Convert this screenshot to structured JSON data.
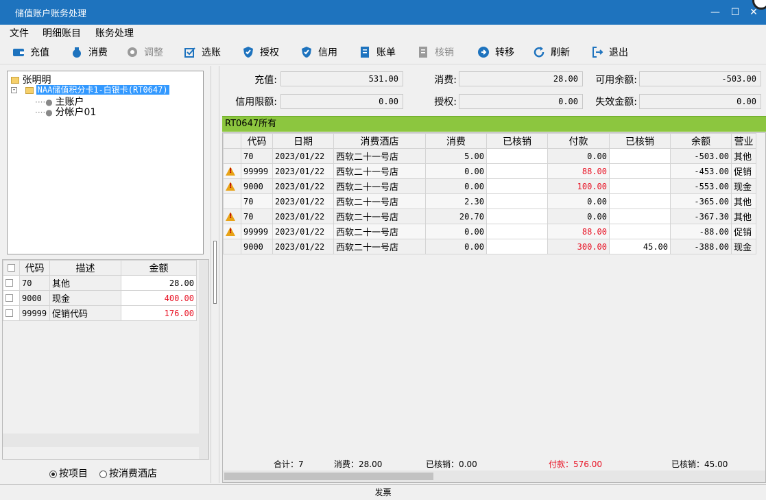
{
  "window": {
    "title": "储值账户账务处理"
  },
  "menu": [
    "文件",
    "明细账目",
    "账务处理"
  ],
  "toolbar": [
    {
      "label": "充值",
      "icon": "wallet-icon",
      "enabled": true
    },
    {
      "label": "消费",
      "icon": "money-bag-icon",
      "enabled": true
    },
    {
      "label": "调整",
      "icon": "adjust-icon",
      "enabled": false
    },
    {
      "label": "选账",
      "icon": "select-account-icon",
      "enabled": true
    },
    {
      "label": "授权",
      "icon": "shield-check-icon",
      "enabled": true
    },
    {
      "label": "信用",
      "icon": "shield-icon",
      "enabled": true
    },
    {
      "label": "账单",
      "icon": "bill-icon",
      "enabled": true
    },
    {
      "label": "核销",
      "icon": "document-icon",
      "enabled": false
    },
    {
      "label": "转移",
      "icon": "arrow-right-circle-icon",
      "enabled": true
    },
    {
      "label": "刷新",
      "icon": "refresh-icon",
      "enabled": true
    },
    {
      "label": "退出",
      "icon": "exit-icon",
      "enabled": true
    }
  ],
  "tree": {
    "root": "张明明",
    "card": "NAA储值积分卡1-白银卡(RT0647)",
    "children": [
      "主账户",
      "分帐户01"
    ]
  },
  "left_grid": {
    "headers": [
      "代码",
      "描述",
      "金额"
    ],
    "rows": [
      {
        "code": "70",
        "desc": "其他",
        "amount": "28.00",
        "red": false
      },
      {
        "code": "9000",
        "desc": "现金",
        "amount": "400.00",
        "red": true
      },
      {
        "code": "99999",
        "desc": "促销代码",
        "amount": "176.00",
        "red": true
      }
    ]
  },
  "group_by": {
    "by_item": "按项目",
    "by_hotel": "按消费酒店",
    "selected": "by_item"
  },
  "summary": {
    "recharge_label": "充值:",
    "recharge": "531.00",
    "consume_label": "消费:",
    "consume": "28.00",
    "available_label": "可用余额:",
    "available": "-503.00",
    "credit_label": "信用限额:",
    "credit": "0.00",
    "auth_label": "授权:",
    "auth": "0.00",
    "expired_label": "失效金额:",
    "expired": "0.00"
  },
  "grid_title": "RT0647所有",
  "main_grid": {
    "headers": [
      "代码",
      "日期",
      "消费酒店",
      "消费",
      "已核销",
      "付款",
      "已核销",
      "余额",
      "营业"
    ],
    "rows": [
      {
        "warn": false,
        "code": "70",
        "date": "2023/01/22",
        "hotel": "西软二十一号店",
        "consume": "5.00",
        "consume_vo": "",
        "pay": "0.00",
        "pay_red": false,
        "pay_vo": "",
        "balance": "-503.00",
        "biz": "其他"
      },
      {
        "warn": true,
        "code": "99999",
        "date": "2023/01/22",
        "hotel": "西软二十一号店",
        "consume": "0.00",
        "consume_vo": "",
        "pay": "88.00",
        "pay_red": true,
        "pay_vo": "",
        "balance": "-453.00",
        "biz": "促销"
      },
      {
        "warn": true,
        "code": "9000",
        "date": "2023/01/22",
        "hotel": "西软二十一号店",
        "consume": "0.00",
        "consume_vo": "",
        "pay": "100.00",
        "pay_red": true,
        "pay_vo": "",
        "balance": "-553.00",
        "biz": "现金"
      },
      {
        "warn": false,
        "code": "70",
        "date": "2023/01/22",
        "hotel": "西软二十一号店",
        "consume": "2.30",
        "consume_vo": "",
        "pay": "0.00",
        "pay_red": false,
        "pay_vo": "",
        "balance": "-365.00",
        "biz": "其他"
      },
      {
        "warn": true,
        "code": "70",
        "date": "2023/01/22",
        "hotel": "西软二十一号店",
        "consume": "20.70",
        "consume_vo": "",
        "pay": "0.00",
        "pay_red": false,
        "pay_vo": "",
        "balance": "-367.30",
        "biz": "其他"
      },
      {
        "warn": true,
        "code": "99999",
        "date": "2023/01/22",
        "hotel": "西软二十一号店",
        "consume": "0.00",
        "consume_vo": "",
        "pay": "88.00",
        "pay_red": true,
        "pay_vo": "",
        "balance": "-88.00",
        "biz": "促销"
      },
      {
        "warn": false,
        "code": "9000",
        "date": "2023/01/22",
        "hotel": "西软二十一号店",
        "consume": "0.00",
        "consume_vo": "",
        "pay": "300.00",
        "pay_red": true,
        "pay_vo": "45.00",
        "balance": "-388.00",
        "biz": "现金"
      }
    ]
  },
  "totals": {
    "count": "合计：7",
    "consume": "消费：28.00",
    "consume_vo": "已核销：0.00",
    "pay": "付款：576.00",
    "pay_vo": "已核销：45.00"
  },
  "status_text": "发票",
  "colors": {
    "titlebar": "#1e73be",
    "grid_header": "#8cc63f",
    "negative": "#e81123",
    "selection": "#3399ff"
  }
}
